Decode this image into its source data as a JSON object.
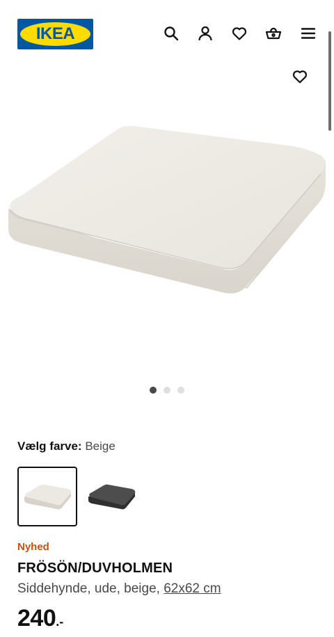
{
  "header": {
    "logo_text": "IKEA",
    "icons": [
      "search-icon",
      "user-icon",
      "heart-icon",
      "basket-icon",
      "menu-icon"
    ]
  },
  "gallery": {
    "favorite_icon": "heart-icon",
    "image_count": 3,
    "active_index": 0
  },
  "color_picker": {
    "label": "Vælg farve:",
    "selected_value": "Beige",
    "swatches": [
      {
        "name": "Beige",
        "color": "#e9e6df",
        "selected": true
      },
      {
        "name": "Mørkegrå",
        "color": "#4a4a4a",
        "selected": false
      }
    ]
  },
  "product": {
    "badge": "Nyhed",
    "name": "FRÖSÖN/DUVHOLMEN",
    "description": "Siddehynde, ude, beige,",
    "size": "62x62 cm",
    "price": "240",
    "price_suffix": ".-"
  },
  "colors": {
    "ikea_blue": "#0058a3",
    "ikea_yellow": "#ffdb00",
    "new_badge": "#ca5008",
    "cushion": "#eceae3"
  }
}
